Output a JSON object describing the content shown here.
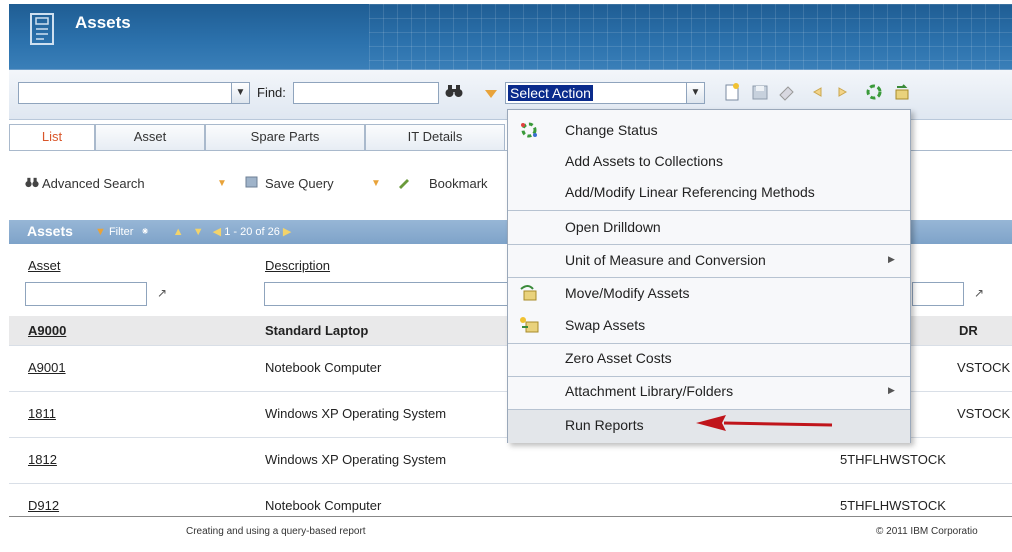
{
  "app": {
    "title": "Assets"
  },
  "toolbar": {
    "find_label": "Find:",
    "find_value": "",
    "action_select_value": "Select Action"
  },
  "tabs": [
    {
      "label": "List",
      "active": true
    },
    {
      "label": "Asset"
    },
    {
      "label": "Spare Parts"
    },
    {
      "label": "IT Details"
    }
  ],
  "query_bar": {
    "advanced_search": "Advanced Search",
    "save_query": "Save Query",
    "bookmark": "Bookmark"
  },
  "table": {
    "title": "Assets",
    "filter_label": "Filter",
    "pagination": "1 - 20 of 26",
    "columns": [
      "Asset",
      "Description"
    ],
    "third_column_partial": "DR",
    "rows": [
      {
        "asset": "A9000",
        "description": "Standard Laptop",
        "third": "DR"
      },
      {
        "asset": "A9001",
        "description": "Notebook Computer",
        "third": "VSTOCK"
      },
      {
        "asset": "1811",
        "description": "Windows XP Operating System",
        "third": "VSTOCK"
      },
      {
        "asset": "1812",
        "description": "Windows XP Operating System",
        "third": "5THFLHWSTOCK"
      },
      {
        "asset": "D912",
        "description": "Notebook Computer",
        "third": "5THFLHWSTOCK"
      }
    ]
  },
  "menu": {
    "items": [
      {
        "label": "Change Status",
        "icon": "change-status-icon"
      },
      {
        "label": "Add Assets to Collections"
      },
      {
        "label": "Add/Modify Linear Referencing Methods"
      },
      {
        "label": "Open Drilldown"
      },
      {
        "label": "Unit of Measure and Conversion",
        "submenu": true
      },
      {
        "label": "Move/Modify Assets",
        "icon": "move-assets-icon"
      },
      {
        "label": "Swap Assets",
        "icon": "swap-assets-icon"
      },
      {
        "label": "Zero Asset Costs"
      },
      {
        "label": "Attachment Library/Folders",
        "submenu": true
      },
      {
        "label": "Run Reports"
      }
    ]
  },
  "footer": {
    "left": "Creating and using a query-based report",
    "right": "© 2011 IBM Corporatio"
  },
  "colors": {
    "header": "#2c72ad",
    "active_tab": "#d9562a",
    "annotation_arrow": "#c0151b"
  }
}
